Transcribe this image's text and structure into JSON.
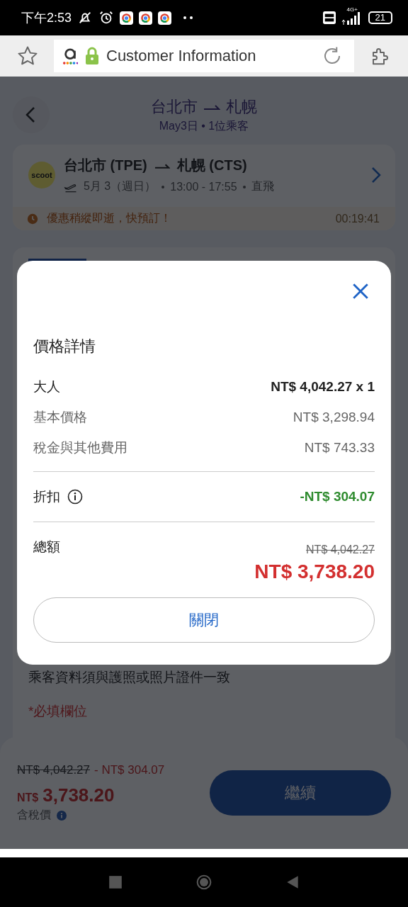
{
  "status_bar": {
    "time": "下午2:53",
    "battery": "21",
    "network": "4G+"
  },
  "browser": {
    "title": "Customer Information"
  },
  "header": {
    "from": "台北市",
    "to": "札幌",
    "subtitle": "May3日 • 1位乘客"
  },
  "flight": {
    "airline_logo": "scoot",
    "origin": "台北市 (TPE)",
    "destination": "札幌 (CTS)",
    "date": "5月 3（週日）",
    "time": "13:00 - 17:55",
    "type": "直飛",
    "promo": "優惠稍縱即逝，快預訂！",
    "timer": "00:19:41"
  },
  "form": {
    "note": "乘客資料須與護照或照片證件一致",
    "required": "*必填欄位"
  },
  "footer": {
    "original_price": "NT$ 4,042.27",
    "discount": "- NT$ 304.07",
    "currency": "NT$",
    "total": "3,738.20",
    "tax_label": "含稅價",
    "continue_button": "繼續"
  },
  "modal": {
    "title": "價格詳情",
    "rows": [
      {
        "kind": "main",
        "label": "大人",
        "value": "NT$ 4,042.27 x 1"
      },
      {
        "kind": "detail",
        "label": "基本價格",
        "value": "NT$ 3,298.94"
      },
      {
        "kind": "detail",
        "label": "稅金與其他費用",
        "value": "NT$ 743.33"
      },
      {
        "kind": "discount",
        "label": "折扣",
        "value": "-NT$ 304.07"
      }
    ],
    "total_label": "總額",
    "total_original": "NT$ 4,042.27",
    "total": "NT$ 3,738.20",
    "close_button": "關閉"
  }
}
